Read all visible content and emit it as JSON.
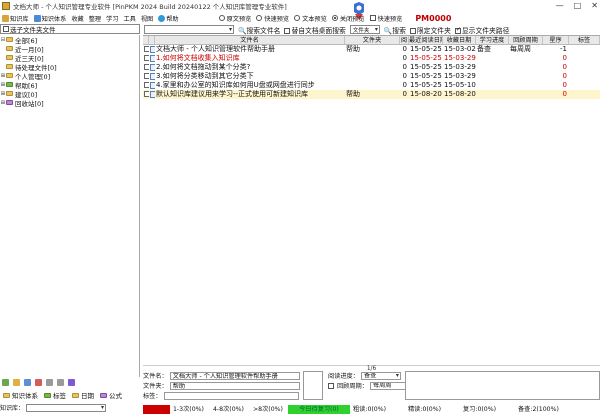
{
  "window": {
    "title": "文档大师 - 个人知识管理专业软件 [PinPKM 2024 Build 20240122 个人知识库管理专业软件]",
    "controls": [
      "—",
      "□",
      "✕"
    ]
  },
  "toolbar": {
    "menus": [
      "知识库",
      "知识体系",
      "收藏",
      "整理",
      "学习",
      "工具",
      "视图",
      "帮助"
    ],
    "radios": [
      {
        "label": "原文预览",
        "on": false
      },
      {
        "label": "快速预览",
        "on": false
      },
      {
        "label": "文本预览",
        "on": false
      },
      {
        "label": "关闭预览",
        "on": true
      },
      {
        "label": "快速预览",
        "on": false
      }
    ],
    "pm": "PM0000"
  },
  "left": {
    "selector_label": "选子文件夹文件",
    "tree": [
      {
        "label": "全部[6]",
        "exp": "⊟",
        "icon": "folder",
        "indent": 0
      },
      {
        "label": "近一月[0]",
        "exp": "",
        "icon": "folder",
        "indent": 0
      },
      {
        "label": "近三天[0]",
        "exp": "",
        "icon": "folder",
        "indent": 0
      },
      {
        "label": "待处理文件[0]",
        "exp": "",
        "icon": "folder",
        "indent": 0
      },
      {
        "label": "个人管理[0]",
        "exp": "⊞",
        "icon": "folder",
        "indent": 0
      },
      {
        "label": "帮助[6]",
        "exp": "⊞",
        "icon": "green",
        "indent": 0
      },
      {
        "label": "建议[0]",
        "exp": "⊞",
        "icon": "folder",
        "indent": 0
      },
      {
        "label": "回收站[0]",
        "exp": "⊞",
        "icon": "purple",
        "indent": 0
      }
    ],
    "tabs": [
      "知识体系",
      "标签",
      "日期",
      "公式"
    ],
    "filter_label": "知识库："
  },
  "search": {
    "button": "搜索文件名",
    "checkbox": "替自文档桌面搜索",
    "combo": "文件夹",
    "search_btn": "搜索",
    "opt1": "限定文件夹",
    "opt2": "显示文件夹路径"
  },
  "grid": {
    "headers": [
      "",
      "",
      "文件名",
      "文件夹",
      "阅",
      "最近阅读日期",
      "收藏日期",
      "学习进度",
      "回顾周期",
      "星序",
      "标签"
    ],
    "rows": [
      {
        "name": "文档大师 - 个人知识管理软件帮助手册",
        "folder": "帮助",
        "n": "0",
        "read": "15-05-25 13:16",
        "fav": "15-03-02",
        "prog": "备查",
        "cycle": "每周周",
        "star": "-1",
        "red": false,
        "sel": false
      },
      {
        "name": "1.如何将文档收集入知识库",
        "folder": "",
        "n": "0",
        "read": "15-05-25 13:16",
        "fav": "15-03-29",
        "prog": "",
        "cycle": "",
        "star": "0",
        "red": true,
        "sel": false
      },
      {
        "name": "2.如何将文档拖动到某个分类?",
        "folder": "",
        "n": "0",
        "read": "15-05-25 13:16",
        "fav": "15-03-29",
        "prog": "",
        "cycle": "",
        "star": "0",
        "red": false,
        "sel": false
      },
      {
        "name": "3.如何将分类移动到其它分类下",
        "folder": "",
        "n": "0",
        "read": "15-05-25 13:16",
        "fav": "15-03-29",
        "prog": "",
        "cycle": "",
        "star": "0",
        "red": false,
        "sel": false
      },
      {
        "name": "4.家里和办公室的知识库如何用U盘或网盘进行同步",
        "folder": "",
        "n": "0",
        "read": "15-05-25 13:16",
        "fav": "15-05-10",
        "prog": "",
        "cycle": "",
        "star": "0",
        "red": false,
        "sel": false
      },
      {
        "name": "默认知识库建议用来学习--正式使用可新建知识库",
        "folder": "帮助",
        "n": "0",
        "read": "15-08-20 23:02",
        "fav": "15-08-20",
        "prog": "",
        "cycle": "",
        "star": "0",
        "red": false,
        "sel": true
      }
    ]
  },
  "pager": "1/6",
  "detail": {
    "name_label": "文件名：",
    "name_value": "文档大师 - 个人知识管理软件帮助手册",
    "folder_label": "文件夹：",
    "folder_value": "帮助",
    "tag_label": "标签：",
    "progress_label": "阅读进度：",
    "progress_value": "备查",
    "cycle_label": "回顾周期：",
    "cycle_value": "每周周"
  },
  "status": {
    "items": [
      "1-3次(0%)",
      "4-8次(0%)",
      ">8次(0%)",
      "今日待复习(0)",
      "粗读:0(0%)",
      "精读:0(0%)",
      "复习:0(0%)",
      "备查:2(100%)"
    ]
  }
}
